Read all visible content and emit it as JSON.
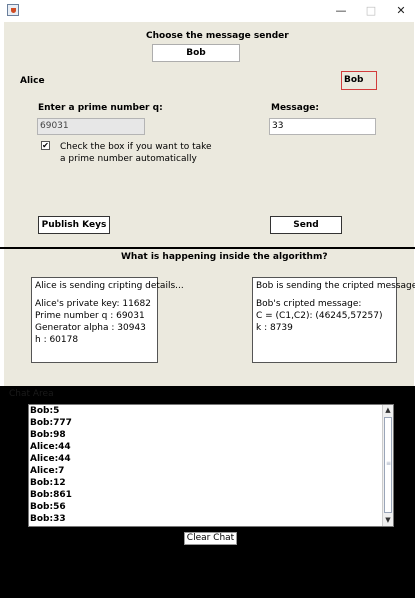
{
  "window": {
    "minimize": "—",
    "maximize": "□",
    "close": "✕"
  },
  "sender": {
    "heading": "Choose the message sender",
    "selected": "Bob"
  },
  "alice_label": "Alice",
  "bob_label": "Bob",
  "prime": {
    "label": "Enter a prime number q:",
    "value": "69031"
  },
  "auto_prime": {
    "checked": true,
    "line1": "Check the box if you want to take",
    "line2": "a prime number automatically"
  },
  "message": {
    "label": "Message:",
    "value": "33"
  },
  "buttons": {
    "publish": "Publish Keys",
    "send": "Send",
    "clear": "Clear Chat"
  },
  "algorithm": {
    "heading": "What is happening inside the algorithm?"
  },
  "alice_box": {
    "title": "Alice is sending cripting details...",
    "lines": [
      "Alice's private key: 11682",
      "Prime number q : 69031",
      "Generator alpha : 30943",
      "h : 60178"
    ]
  },
  "bob_box": {
    "title": "Bob is sending the cripted message...",
    "lines": [
      "Bob's cripted message:",
      "C = (C1,C2): (46245,57257)",
      "k : 8739"
    ]
  },
  "chat": {
    "label": "Chat Area",
    "messages": [
      "Bob:5",
      "Bob:777",
      "Bob:98",
      "Alice:44",
      "Alice:44",
      "Alice:7",
      "Bob:12",
      "Bob:861",
      "Bob:56",
      "Bob:33"
    ]
  },
  "colors": {
    "panel_bg": "#ebe9de",
    "accent_red": "#d23b3b",
    "chat_bg": "#000000"
  }
}
